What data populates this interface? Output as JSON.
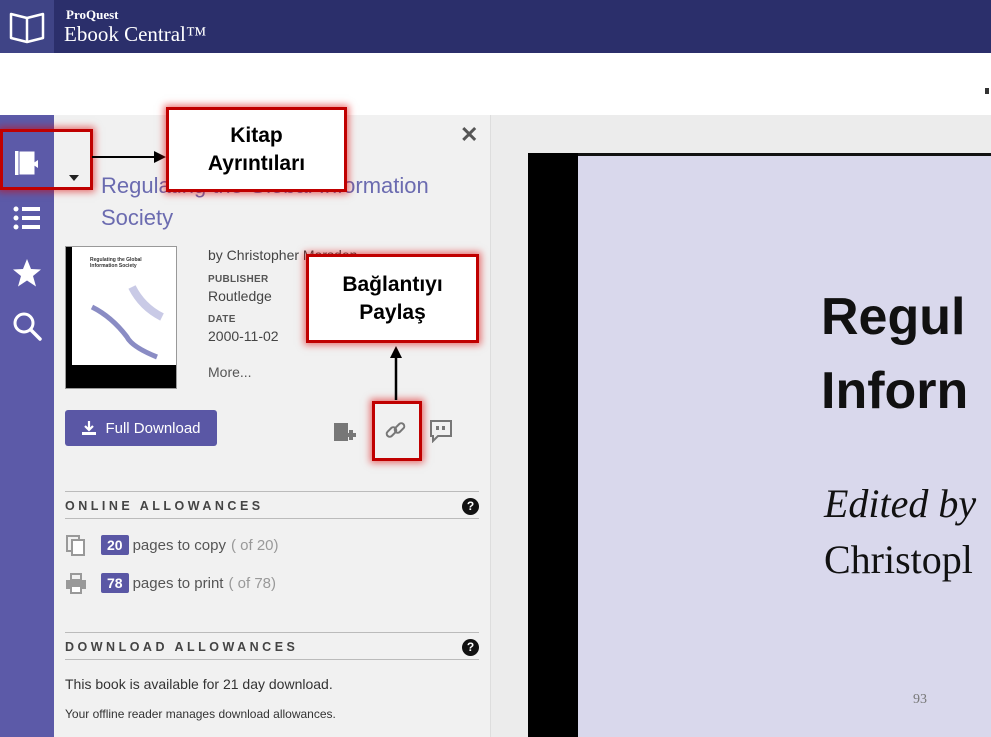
{
  "header": {
    "brand_small": "ProQuest",
    "brand_big": "Ebook Central™"
  },
  "book": {
    "title": "Regulating the Global Information Society",
    "author": "by Christopher Marsden",
    "publisher_label": "PUBLISHER",
    "publisher": "Routledge",
    "date_label": "DATE",
    "date": "2000-11-02",
    "more": "More...",
    "cover_line1": "Regulating the Global",
    "cover_line2": "Information Society"
  },
  "actions": {
    "full_download": "Full Download"
  },
  "online_allowances": {
    "title": "ONLINE ALLOWANCES",
    "copy_count": "20",
    "copy_text": "pages to copy",
    "copy_total": "( of 20)",
    "print_count": "78",
    "print_text": "pages to print",
    "print_total": "( of 78)"
  },
  "download_allowances": {
    "title": "DOWNLOAD ALLOWANCES",
    "line1": "This book is available for 21 day download.",
    "line2": "Your offline reader manages download allowances."
  },
  "reader_page": {
    "title_line1": "Regul",
    "title_line2": "Inforn",
    "edited_by": "Edited by",
    "author": "Christopl",
    "page_number": "93"
  },
  "annotations": {
    "book_details": "Kitap Ayrıntıları",
    "share_link": "Bağlantıyı Paylaş"
  },
  "colors": {
    "header": "#2b2f6b",
    "sidenav": "#5c5aa8",
    "accent": "#5a57a5",
    "highlight": "#c00000"
  }
}
